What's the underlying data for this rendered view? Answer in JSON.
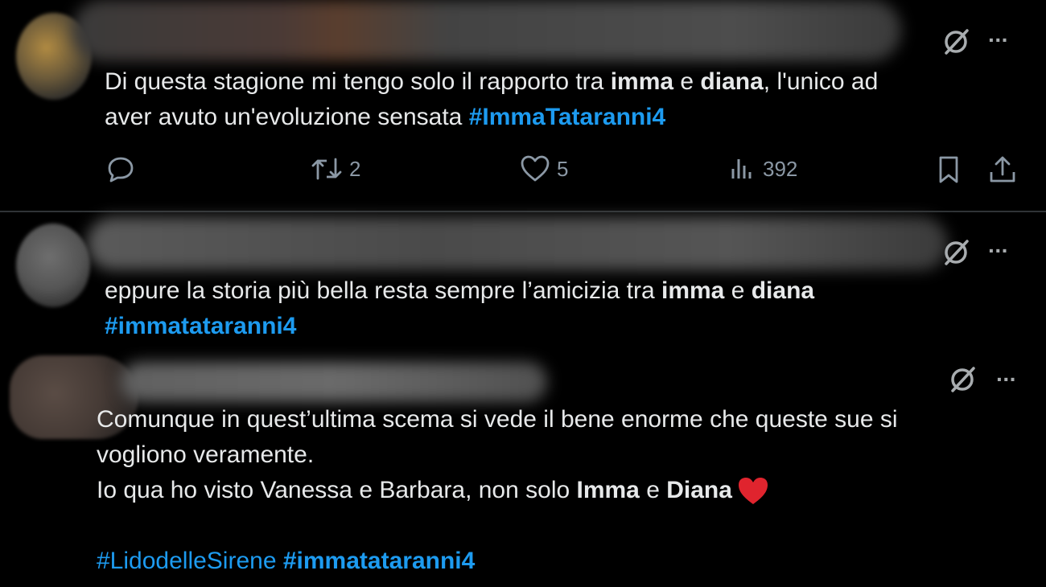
{
  "tweets": [
    {
      "text_parts": [
        {
          "t": "Di questa stagione mi tengo solo il rapporto tra ",
          "s": "normal"
        },
        {
          "t": "imma",
          "s": "bold"
        },
        {
          "t": " e ",
          "s": "normal"
        },
        {
          "t": "diana",
          "s": "bold"
        },
        {
          "t": ", l'unico ad",
          "s": "normal"
        }
      ],
      "line2_text": "aver avuto un'evoluzione sensata ",
      "hashtag": "#ImmaTataranni4",
      "actions": {
        "reply_count": "",
        "retweet_count": "2",
        "like_count": "5",
        "views_count": "392"
      }
    },
    {
      "line1": [
        {
          "t": "eppure la storia più bella resta sempre l’amicizia tra ",
          "s": "normal"
        },
        {
          "t": "imma",
          "s": "bold"
        },
        {
          "t": " e ",
          "s": "normal"
        },
        {
          "t": "diana",
          "s": "bold"
        }
      ],
      "hashtag": "#immatataranni4"
    },
    {
      "line1": "Comunque in quest’ultima scema si vede il bene enorme che queste sue si",
      "line2": "vogliono veramente.",
      "line3_parts": [
        {
          "t": "Io qua ho visto Vanessa e Barbara, non solo ",
          "s": "normal"
        },
        {
          "t": "Imma",
          "s": "bold"
        },
        {
          "t": " e ",
          "s": "normal"
        },
        {
          "t": "Diana",
          "s": "bold"
        }
      ],
      "hashtag_1": "#LidodelleSirene",
      "hashtag_2": "#immatataranni4"
    }
  ],
  "icons": {
    "grok": "slashed-circle-icon",
    "more": "more-dots-icon",
    "reply": "reply-icon",
    "retweet": "retweet-icon",
    "like": "heart-icon",
    "views": "views-icon",
    "bookmark": "bookmark-icon",
    "share": "share-icon",
    "emoji": "red-heart-emoji"
  },
  "more_glyph": "···",
  "colors": {
    "background": "#000000",
    "text": "#e7e9ea",
    "hashtag": "#1d9bf0",
    "muted": "#8b98a5",
    "heart": "#e0242e"
  }
}
